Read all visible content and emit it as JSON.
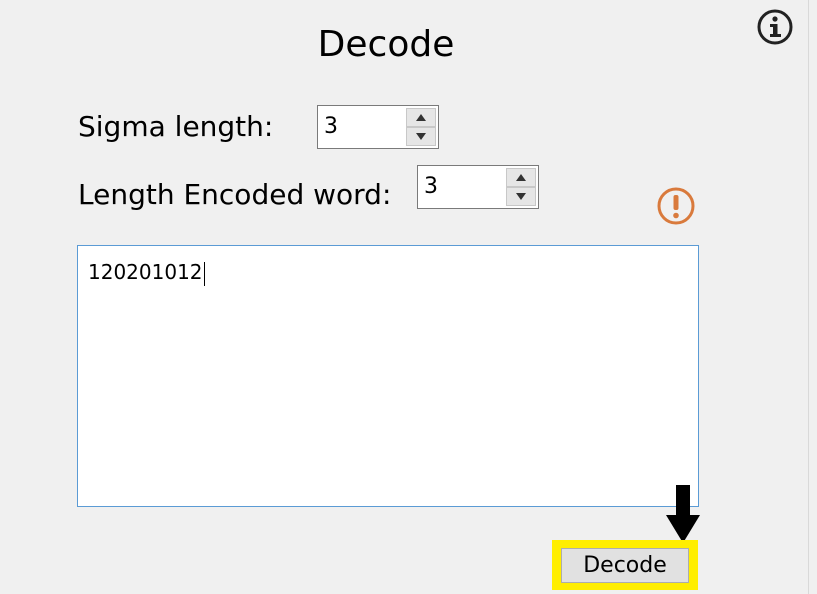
{
  "title": "Decode",
  "sigma": {
    "label": "Sigma length:",
    "value": "3"
  },
  "length_encoded": {
    "label": "Length Encoded word:",
    "value": "3"
  },
  "input": {
    "text": "120201012"
  },
  "decode_button": {
    "label": "Decode"
  },
  "icons": {
    "info": "info-icon",
    "warning": "exclamation-circle-icon",
    "arrow": "arrow-down-icon",
    "spin_up": "chevron-up-icon",
    "spin_down": "chevron-down-icon"
  },
  "colors": {
    "background": "#f0f0f0",
    "highlight": "#ffee00",
    "warning": "#d97a3c",
    "textarea_border": "#5b9bd5"
  }
}
